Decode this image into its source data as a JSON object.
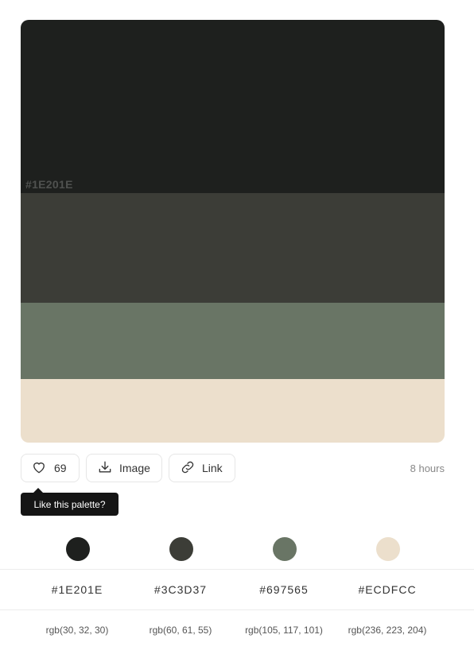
{
  "palette": {
    "colors": [
      {
        "hex": "#1E201E",
        "rgb": "rgb(30, 32, 30)",
        "value": "#1e201e"
      },
      {
        "hex": "#3C3D37",
        "rgb": "rgb(60, 61, 55)",
        "value": "#3c3d37"
      },
      {
        "hex": "#697565",
        "rgb": "rgb(105, 117, 101)",
        "value": "#697565"
      },
      {
        "hex": "#ECDFCC",
        "rgb": "rgb(236, 223, 204)",
        "value": "#ecdfcc"
      }
    ],
    "overlay_hex": "#1E201E"
  },
  "actions": {
    "like_count": "69",
    "image_label": "Image",
    "link_label": "Link",
    "time_ago": "8 hours"
  },
  "tooltip": {
    "text": "Like this palette?"
  },
  "icons": {
    "like": "heart-icon",
    "image": "download-icon",
    "link": "link-icon"
  }
}
